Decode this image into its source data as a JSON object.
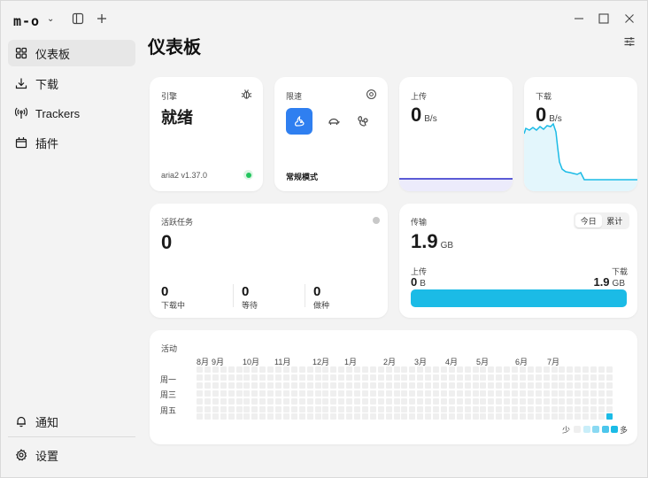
{
  "app": {
    "logo": "m-o"
  },
  "sidebar": {
    "items": [
      {
        "label": "仪表板"
      },
      {
        "label": "下载"
      },
      {
        "label": "Trackers"
      },
      {
        "label": "插件"
      }
    ],
    "bottom": [
      {
        "label": "通知"
      },
      {
        "label": "设置"
      }
    ]
  },
  "page": {
    "title": "仪表板"
  },
  "engine": {
    "label": "引擎",
    "status": "就绪",
    "version": "aria2 v1.37.0",
    "status_color": "#22c55e"
  },
  "speed_limit": {
    "label": "限速",
    "mode": "常规模式",
    "modes": [
      "常规模式",
      "turtle",
      "squirrel"
    ]
  },
  "upload": {
    "label": "上传",
    "value": "0",
    "unit": "B/s"
  },
  "download": {
    "label": "下载",
    "value": "0",
    "unit": "B/s"
  },
  "active_tasks": {
    "label": "活跃任务",
    "total": "0",
    "stats": [
      {
        "value": "0",
        "label": "下载中"
      },
      {
        "value": "0",
        "label": "等待"
      },
      {
        "value": "0",
        "label": "做种"
      }
    ]
  },
  "transfer": {
    "label": "传输",
    "total": "1.9",
    "total_unit": "GB",
    "tabs": [
      "今日",
      "累计"
    ],
    "upload_label": "上传",
    "upload_value": "0",
    "upload_unit": "B",
    "download_label": "下载",
    "download_value": "1.9",
    "download_unit": "GB",
    "download_fraction": 1.0,
    "bar_color": "#1bbbe6"
  },
  "activity": {
    "label": "活动",
    "months": [
      "8月",
      "9月",
      "10月",
      "11月",
      "12月",
      "1月",
      "2月",
      "3月",
      "4月",
      "5月",
      "6月",
      "7月"
    ],
    "days": [
      "周一",
      "周三",
      "周五"
    ],
    "legend_less": "少",
    "legend_more": "多",
    "legend_colors": [
      "#efefef",
      "#c9eef9",
      "#8ad9f2",
      "#4cc6ec",
      "#1bbbe6"
    ],
    "weeks": 53,
    "active_cell": {
      "week": 52,
      "day": 6,
      "level": 4
    }
  },
  "colors": {
    "accent": "#2f7ff0",
    "cyan": "#1bbbe6",
    "upload_line": "#5b5bd6"
  }
}
